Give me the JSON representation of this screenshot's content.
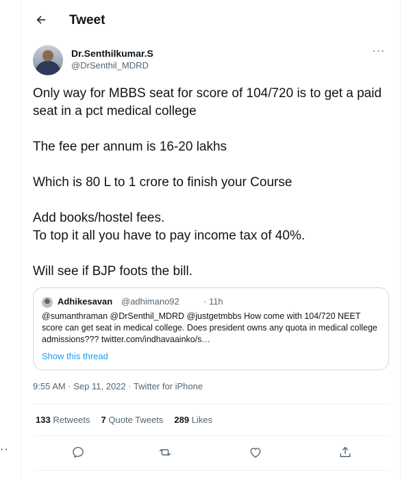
{
  "header": {
    "title": "Tweet",
    "back_icon": "arrow-left-icon"
  },
  "author": {
    "name": "Dr.Senthilkumar.S",
    "handle": "@DrSenthil_MDRD",
    "more_label": "···"
  },
  "tweet": {
    "paragraphs": [
      "Only way for MBBS seat for score of 104/720 is to get a paid seat in a pct medical college",
      "The fee per annum is 16-20 lakhs",
      "Which is 80 L to 1 crore to finish your Course",
      "Add books/hostel fees.\nTo top it all you have to pay income tax of 40%.",
      "Will see if BJP foots the bill."
    ]
  },
  "quote": {
    "name": "Adhikesavan",
    "handle": "@adhimano92",
    "time": "· 11h",
    "text": "@sumanthraman @DrSenthil_MDRD @justgetmbbs  How come with 104/720 NEET score can get seat in medical college. Does president owns any quota in medical college admissions??? twitter.com/indhavaainko/s…",
    "show_thread": "Show this thread"
  },
  "meta": {
    "timestamp": "9:55 AM · Sep 11, 2022 · Twitter for iPhone"
  },
  "stats": {
    "retweets_count": "133",
    "retweets_label": "Retweets",
    "quotes_count": "7",
    "quotes_label": "Quote Tweets",
    "likes_count": "289",
    "likes_label": "Likes"
  },
  "actions": [
    "reply-icon",
    "retweet-icon",
    "like-icon",
    "share-icon"
  ],
  "sidebar": {
    "more_dots": "··"
  },
  "colors": {
    "accent": "#1d9bf0",
    "text": "#0f1419",
    "muted": "#536471",
    "border": "#cfd9de"
  }
}
